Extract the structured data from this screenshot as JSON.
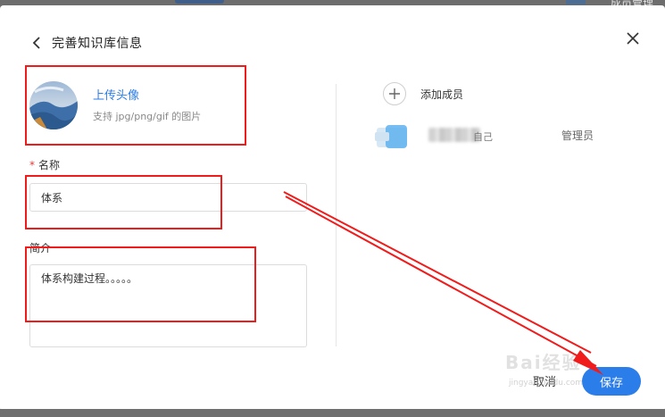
{
  "dialog": {
    "title": "完善知识库信息"
  },
  "avatar_section": {
    "upload_label": "上传头像",
    "hint": "支持 jpg/png/gif 的图片"
  },
  "form": {
    "name_label": "名称",
    "required_mark": "*",
    "name_value": "体系",
    "intro_label": "简介",
    "intro_value": "体系构建过程。。。。。"
  },
  "members": {
    "add_label": "添加成员",
    "list": [
      {
        "name_suffix": "自己",
        "role": "管理员"
      }
    ]
  },
  "footer": {
    "cancel_label": "取消",
    "save_label": "保存"
  },
  "background": {
    "top_right_text": "成员管理"
  },
  "watermark": {
    "text": "Bai经验",
    "sub": "jingyan.baidu.com"
  },
  "colors": {
    "accent": "#2b7de9",
    "annotation": "#f01c1c",
    "required": "#e5393b"
  }
}
